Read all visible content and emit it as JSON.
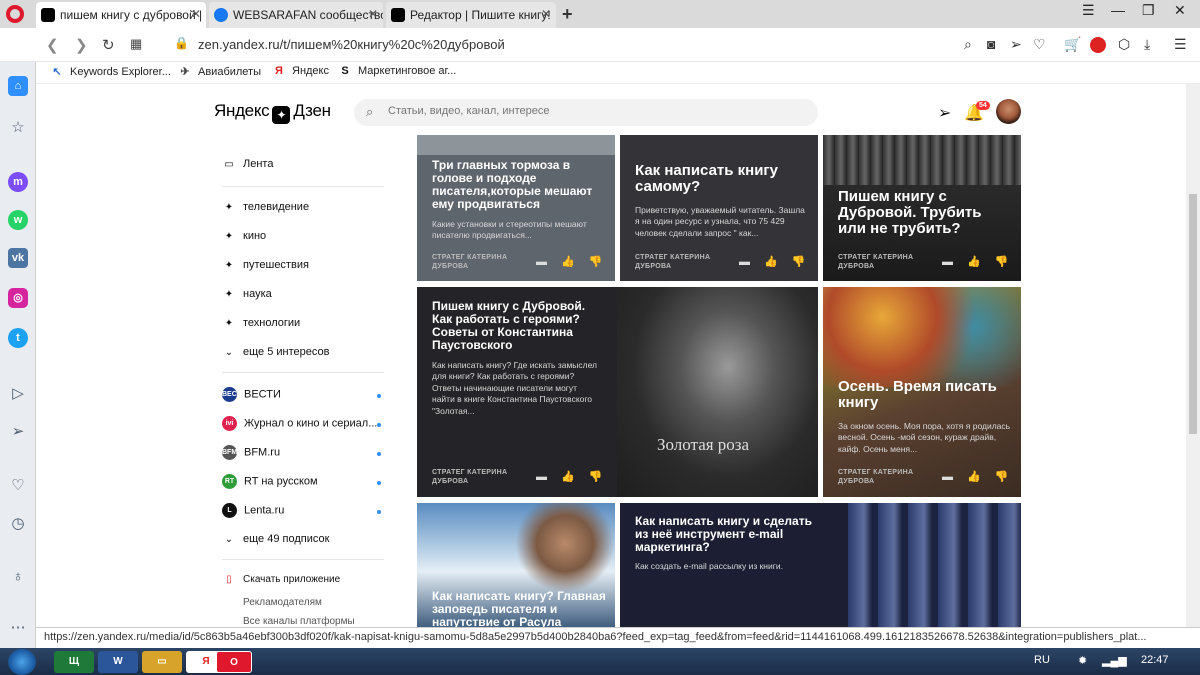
{
  "browser": {
    "tabs": [
      {
        "title": "пишем книгу с дубровой |",
        "active": true
      },
      {
        "title": "WEBSARAFAN сообщество"
      },
      {
        "title": "Редактор | Пишите книгу!"
      }
    ],
    "url": "zen.yandex.ru/t/пишем%20книгу%20с%20дубровой",
    "bookmarks": [
      "Keywords Explorer...",
      "Авиабилеты",
      "Яндекс",
      "Маркетинговое аг..."
    ],
    "status_url": "https://zen.yandex.ru/media/id/5c863b5a46ebf300b3df020f/kak-napisat-knigu-samomu-5d8a5e2997b5d400b2840ba6?feed_exp=tag_feed&from=feed&rid=1144161068.499.1612183526678.52638&integration=publishers_plat..."
  },
  "zen": {
    "logo": "Яндекс",
    "logo2": "Дзен",
    "search_placeholder": "Статьи, видео, канал, интересе",
    "notif_count": "54",
    "menu": {
      "feed": "Лента",
      "interests": [
        "телевидение",
        "кино",
        "путешествия",
        "наука",
        "технологии"
      ],
      "more_interests": "еще 5 интересов",
      "channels": [
        "ВЕСТИ",
        "Журнал о кино и сериал...",
        "BFM.ru",
        "RT на русском",
        "Lenta.ru"
      ],
      "channel_icons": [
        "ВЕСТИ",
        "ivi",
        "BFM",
        "RT",
        "L"
      ],
      "more_subs": "еще 49 подписок",
      "download_app": "Скачать приложение",
      "advertisers": "Рекламодателям",
      "all_channels": "Все каналы платформы"
    },
    "cards": [
      {
        "title": "Три главных тормоза в голове и подходе писателя,которые мешают ему продвигаться",
        "desc": "Какие установки и стереотипы мешают писателю продвигаться...",
        "author": "СТРАТЕГ КАТЕРИНА ДУБРОВА"
      },
      {
        "title": "Как написать книгу самому?",
        "desc": "Приветствую, уважаемый читатель. Зашла я на один ресурс и узнала, что 75 429  человек сделали запрос \" как...",
        "author": "СТРАТЕГ КАТЕРИНА ДУБРОВА"
      },
      {
        "title": "Пишем книгу с Дубровой. Трубить или не трубить?",
        "desc": "",
        "author": "СТРАТЕГ КАТЕРИНА ДУБРОВА"
      },
      {
        "title": "Пишем книгу с Дубровой. Как работать с героями? Советы от Константина Паустовского",
        "desc": "Как написать книгу? Где искать замыслел для книги? Как работать с героями? Ответы начинающие писатели могут найти в книге Константина Паустовского \"Золотая...",
        "author": "СТРАТЕГ КАТЕРИНА ДУБРОВА",
        "image_text": "Золотая роза"
      },
      {
        "title": "Осень. Время писать книгу",
        "desc": "За окном осень.  Моя пора, хотя я родилась весной. Осень -мой сезон, кураж драйв, кайф. Осень меня...",
        "author": "СТРАТЕГ КАТЕРИНА ДУБРОВА"
      },
      {
        "title": "Как написать книгу? Главная заповедь писателя и напутствие от Расула",
        "desc": "",
        "author": ""
      },
      {
        "title": "Как написать книгу и сделать из неё инструмент e-mail маркетинга?",
        "desc": "Как создать e-mail рассылку из книги.",
        "author": ""
      }
    ]
  },
  "taskbar": {
    "lang": "RU",
    "time": "22:47"
  },
  "colors": {
    "opera_red": "#e0182d",
    "card_gray": "#5f656c",
    "card_dark": "#2a2a2e",
    "accent_blue": "#2f8fff"
  }
}
